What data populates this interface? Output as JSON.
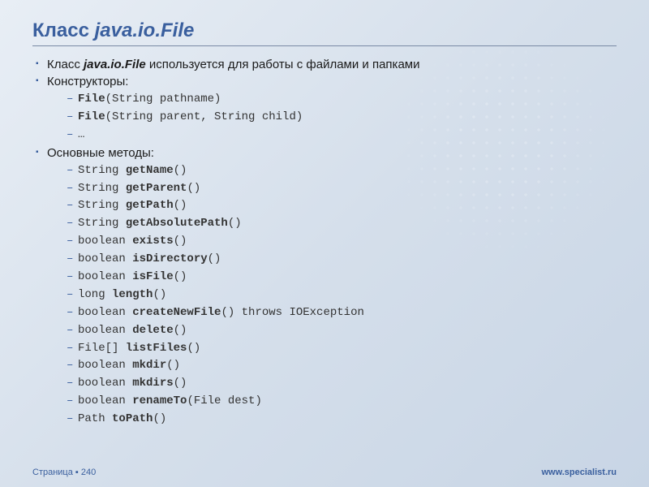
{
  "title_prefix": "Класс ",
  "title_class": "java.io.File",
  "bullets": {
    "b0_pre": "Класс ",
    "b0_class": "java.io.File",
    "b0_post": " используется для работы с файлами и папками",
    "b1": "Конструкторы:",
    "b2": "Основные методы:"
  },
  "ctors": [
    {
      "bold": "File",
      "rest": "(String pathname)"
    },
    {
      "bold": "File",
      "rest": "(String parent, String child)"
    },
    {
      "bold": "",
      "rest": "…"
    }
  ],
  "methods": [
    {
      "ret": "String ",
      "name": "getName",
      "rest": "()"
    },
    {
      "ret": "String ",
      "name": "getParent",
      "rest": "()"
    },
    {
      "ret": "String ",
      "name": "getPath",
      "rest": "()"
    },
    {
      "ret": "String ",
      "name": "getAbsolutePath",
      "rest": "()"
    },
    {
      "ret": "boolean ",
      "name": "exists",
      "rest": "()"
    },
    {
      "ret": "boolean ",
      "name": "isDirectory",
      "rest": "()"
    },
    {
      "ret": "boolean ",
      "name": "isFile",
      "rest": "()"
    },
    {
      "ret": "long ",
      "name": "length",
      "rest": "()"
    },
    {
      "ret": "boolean ",
      "name": "createNewFile",
      "rest": "() throws IOException"
    },
    {
      "ret": "boolean ",
      "name": "delete",
      "rest": "()"
    },
    {
      "ret": "File[] ",
      "name": "listFiles",
      "rest": "()"
    },
    {
      "ret": "boolean ",
      "name": "mkdir",
      "rest": "()"
    },
    {
      "ret": "boolean ",
      "name": "mkdirs",
      "rest": "()"
    },
    {
      "ret": "boolean ",
      "name": "renameTo",
      "rest": "(File dest)"
    },
    {
      "ret": "Path ",
      "name": "toPath",
      "rest": "()"
    }
  ],
  "footer": {
    "page": "Страница ▪ 240",
    "site": "www.specialist.ru"
  }
}
